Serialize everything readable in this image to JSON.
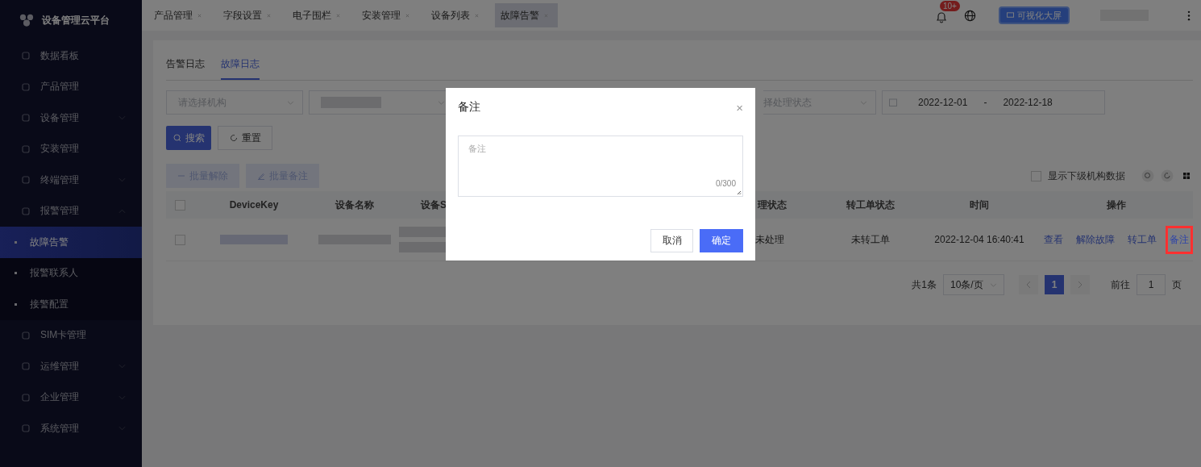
{
  "sidebar": {
    "logo": "设备管理云平台",
    "items": [
      {
        "label": "数据看板",
        "selected": false
      },
      {
        "label": "产品管理",
        "selected": false
      },
      {
        "label": "设备管理",
        "selected": false,
        "expanded": false
      },
      {
        "label": "安装管理",
        "selected": false
      },
      {
        "label": "终端管理",
        "selected": false,
        "expanded": false
      },
      {
        "label": "报警管理",
        "selected": false,
        "expanded": true,
        "children": [
          {
            "label": "故障告警",
            "selected": true
          },
          {
            "label": "报警联系人",
            "selected": false
          },
          {
            "label": "接警配置",
            "selected": false
          }
        ]
      },
      {
        "label": "SIM卡管理",
        "selected": false
      },
      {
        "label": "运维管理",
        "selected": false,
        "expanded": false
      },
      {
        "label": "企业管理",
        "selected": false,
        "expanded": false
      },
      {
        "label": "系统管理",
        "selected": false,
        "expanded": false
      }
    ]
  },
  "top_tabs": [
    {
      "label": "产品管理",
      "selected": false
    },
    {
      "label": "字段设置",
      "selected": false
    },
    {
      "label": "电子围栏",
      "selected": false
    },
    {
      "label": "安装管理",
      "selected": false
    },
    {
      "label": "设备列表",
      "selected": false
    },
    {
      "label": "故障告警",
      "selected": true
    }
  ],
  "header": {
    "notification_badge": "10+",
    "screen_button": "可视化大屏"
  },
  "page_tabs": [
    {
      "label": "告警日志",
      "selected": false
    },
    {
      "label": "故障日志",
      "selected": true
    }
  ],
  "filters": {
    "org_placeholder": "请选择机构",
    "status_placeholder": "择处理状态",
    "date_start": "2022-12-01",
    "date_separator": "-",
    "date_end": "2022-12-18"
  },
  "buttons": {
    "search": "搜索",
    "reset": "重置",
    "batch_release": "批量解除",
    "batch_note": "批量备注"
  },
  "sub_org": {
    "label": "显示下级机构数据",
    "checked": false
  },
  "table": {
    "header_checked": false,
    "columns": [
      "DeviceKey",
      "设备名称",
      "设备S",
      "理状态",
      "转工单状态",
      "时间",
      "操作"
    ],
    "rows": [
      {
        "checked": false,
        "status": "未处理",
        "order_status": "未转工单",
        "time": "2022-12-04 16:40:41",
        "actions": [
          {
            "label": "查看",
            "highlighted": false
          },
          {
            "label": "解除故障",
            "highlighted": false
          },
          {
            "label": "转工单",
            "highlighted": false
          },
          {
            "label": "备注",
            "highlighted": true
          }
        ]
      }
    ]
  },
  "pagination": {
    "total": "共1条",
    "page_size": "10条/页",
    "pages": [
      {
        "label": "1",
        "selected": true
      }
    ],
    "goto_label": "前往",
    "goto_value": "1",
    "page_unit": "页"
  },
  "dialog": {
    "title": "备注",
    "close": "×",
    "placeholder": "备注",
    "counter": "0/300",
    "cancel": "取消",
    "confirm": "确定"
  }
}
